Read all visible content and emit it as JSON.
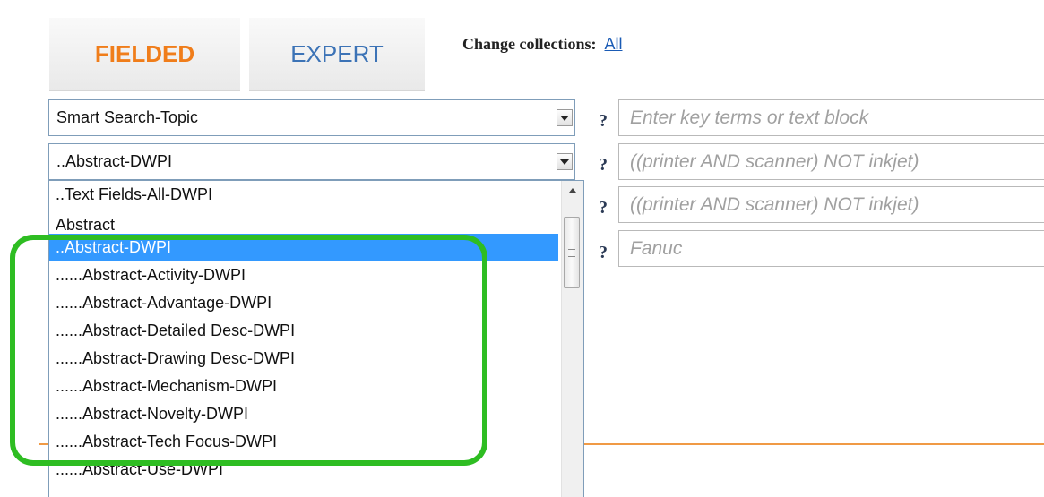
{
  "tabs": {
    "fielded": "FIELDED",
    "expert": "EXPERT"
  },
  "collections": {
    "label": "Change collections:",
    "link": "All"
  },
  "rows": [
    {
      "field": "Smart Search-Topic",
      "placeholder": "Enter key terms or text block"
    },
    {
      "field": "..Abstract-DWPI",
      "placeholder": "((printer AND scanner) NOT inkjet)"
    },
    {
      "placeholder": "((printer AND scanner) NOT inkjet)"
    },
    {
      "placeholder": "Fanuc"
    }
  ],
  "help_glyph": "?",
  "dropdown": {
    "items": [
      "..Text Fields-All-DWPI",
      "Abstract",
      "..Abstract-DWPI",
      "......Abstract-Activity-DWPI",
      "......Abstract-Advantage-DWPI",
      "......Abstract-Detailed Desc-DWPI",
      "......Abstract-Drawing Desc-DWPI",
      "......Abstract-Mechanism-DWPI",
      "......Abstract-Novelty-DWPI",
      "......Abstract-Tech Focus-DWPI",
      "......Abstract-Use-DWPI"
    ],
    "selected": "..Abstract-DWPI"
  },
  "icons": {
    "dropdown_arrow": "triangle-down-icon",
    "scroll_up": "triangle-up-icon",
    "help": "question-mark-icon"
  },
  "colors": {
    "fielded_tab": "#f07d1a",
    "expert_tab": "#3c73b6",
    "link": "#1a5bb5",
    "selection": "#3399ff",
    "highlight_box": "#2ebd22",
    "rule": "#f09a45"
  }
}
